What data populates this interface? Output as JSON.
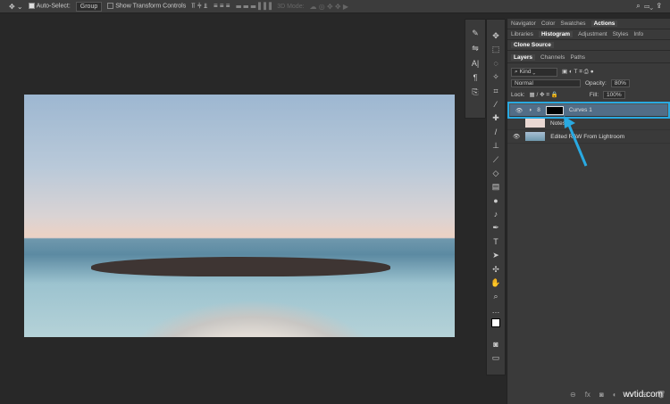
{
  "options_bar": {
    "auto_select_label": "Auto-Select:",
    "auto_select_value": "Group",
    "transform_label": "Show Transform Controls",
    "mode_3d": "3D Mode:"
  },
  "panels": {
    "row1": [
      "Navigator",
      "Color",
      "Swatches",
      "Actions"
    ],
    "row2": [
      "Libraries",
      "Histogram",
      "Adjustment",
      "Styles",
      "Info"
    ],
    "row3": [
      "Clone Source"
    ],
    "layers_tabs": [
      "Layers",
      "Channels",
      "Paths"
    ],
    "filter_kind": "Kind",
    "blend_mode": "Normal",
    "opacity_label": "Opacity:",
    "opacity_value": "80%",
    "lock_label": "Lock:",
    "fill_label": "Fill:",
    "fill_value": "100%",
    "layers": [
      {
        "name": "Curves 1",
        "visible": true,
        "selected": true
      },
      {
        "name": "Notes",
        "visible": false
      },
      {
        "name": "Edited RAW From Lightroom",
        "visible": true
      }
    ]
  },
  "watermark": "wvtid.com",
  "accent": "#29a9e1"
}
